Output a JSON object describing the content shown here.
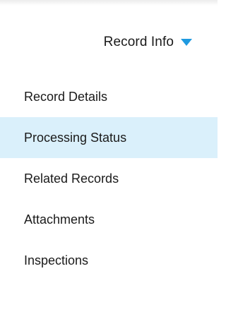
{
  "header": {
    "label": "Record Info",
    "caret_icon": "caret-down-icon",
    "accent_color": "#1f9ae0"
  },
  "menu": {
    "active_index": 1,
    "active_background": "#daf0fb",
    "items": [
      {
        "label": "Record Details"
      },
      {
        "label": "Processing Status"
      },
      {
        "label": "Related Records"
      },
      {
        "label": "Attachments"
      },
      {
        "label": "Inspections"
      }
    ]
  }
}
